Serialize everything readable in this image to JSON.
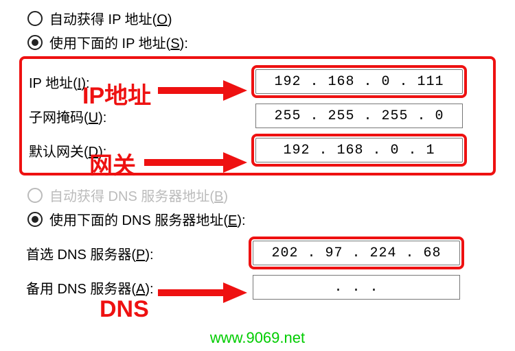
{
  "ip_section": {
    "auto_label_pre": "自动获得 IP 地址(",
    "auto_hotkey": "O",
    "auto_label_post": ")",
    "manual_label_pre": "使用下面的 IP 地址(",
    "manual_hotkey": "S",
    "manual_label_post": "):",
    "ip_label_pre": "IP 地址(",
    "ip_hotkey": "I",
    "ip_label_post": "):",
    "ip_value": "192 . 168 .  0  . 111",
    "mask_label_pre": "子网掩码(",
    "mask_hotkey": "U",
    "mask_label_post": "):",
    "mask_value": "255 . 255 . 255 .  0",
    "gw_label_pre": "默认网关(",
    "gw_hotkey": "D",
    "gw_label_post": "):",
    "gw_value": "192 . 168 .  0  .  1"
  },
  "dns_section": {
    "auto_label_pre": "自动获得 DNS 服务器地址(",
    "auto_hotkey": "B",
    "auto_label_post": ")",
    "manual_label_pre": "使用下面的 DNS 服务器地址(",
    "manual_hotkey": "E",
    "manual_label_post": "):",
    "pref_label_pre": "首选 DNS 服务器(",
    "pref_hotkey": "P",
    "pref_label_post": "):",
    "pref_value": "202 .  97 . 224 . 68",
    "alt_label_pre": "备用 DNS 服务器(",
    "alt_hotkey": "A",
    "alt_label_post": "):",
    "alt_value": ".       .       ."
  },
  "annotations": {
    "ip": "IP地址",
    "gw": "网关",
    "dns": "DNS"
  },
  "watermark": "www.9069.net"
}
